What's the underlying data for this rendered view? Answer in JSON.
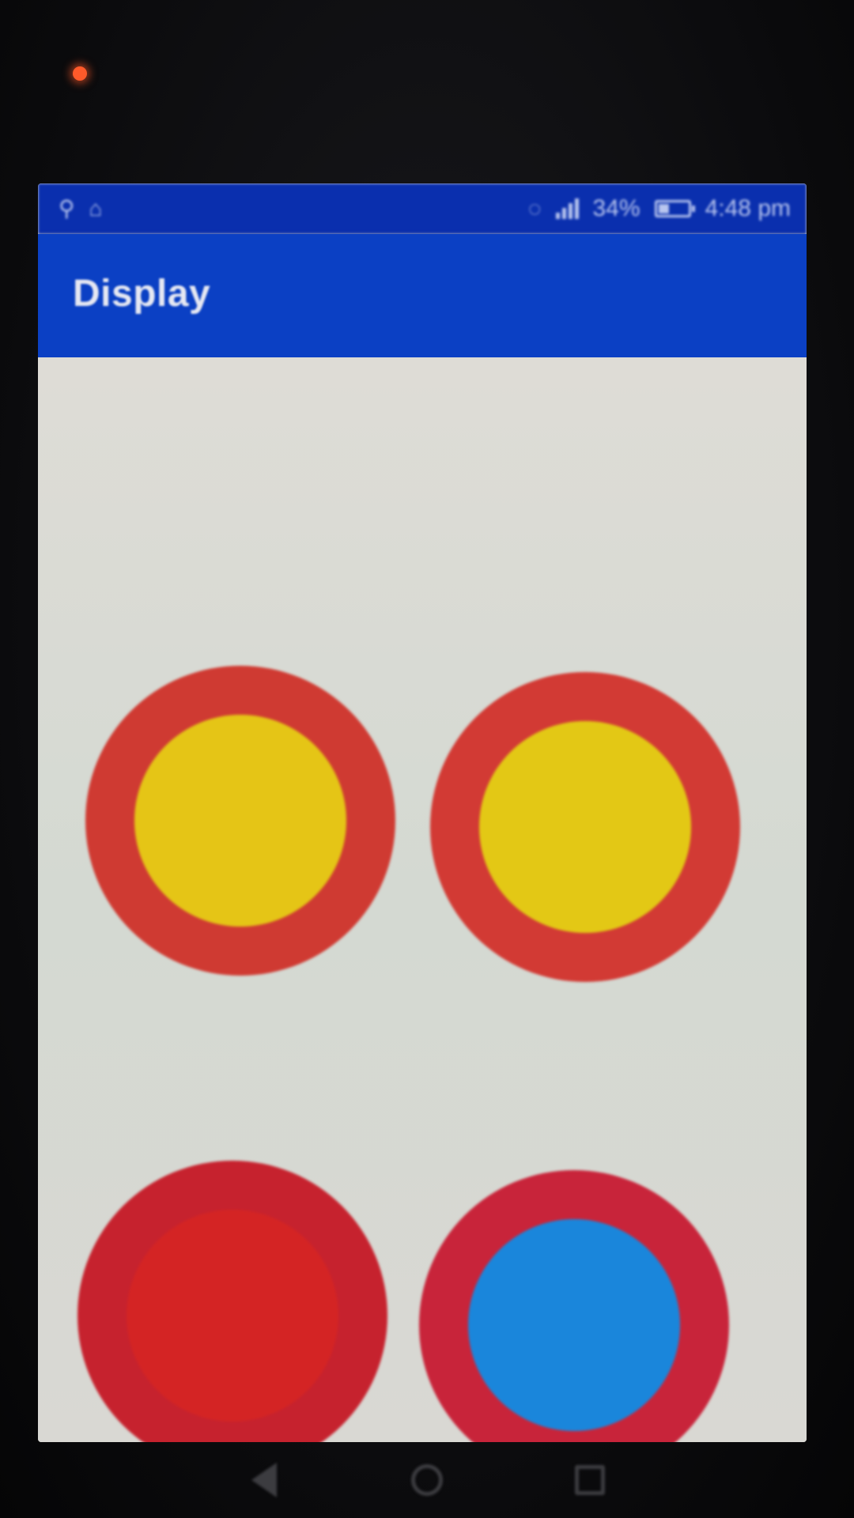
{
  "status_bar": {
    "left_icons": [
      "usb-icon",
      "notification-icon"
    ],
    "signal_icon": "signal-icon",
    "battery_percent": "34%",
    "time": "4:48 pm",
    "background": "#0a2fae"
  },
  "app_bar": {
    "title": "Display",
    "background": "#0b40c4"
  },
  "toggles": [
    {
      "ring_color": "#cf3a32",
      "inner_color": "#e5c516"
    },
    {
      "ring_color": "#d23a34",
      "inner_color": "#e3c815"
    },
    {
      "ring_color": "#c6222e",
      "inner_color": "#d42424"
    },
    {
      "ring_color": "#c8243a",
      "inner_color": "#1a86db"
    }
  ],
  "nav_bar": {
    "buttons": [
      "back-icon",
      "home-icon",
      "recents-icon"
    ]
  }
}
